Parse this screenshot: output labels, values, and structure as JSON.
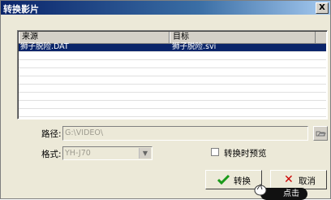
{
  "window": {
    "title": "转换影片",
    "close_label": "X"
  },
  "list": {
    "columns": [
      "来源",
      "目标"
    ],
    "rows": [
      {
        "source": "狮子脱险.DAT",
        "target": "狮子脱险.svi",
        "selected": true
      }
    ]
  },
  "path": {
    "label": "路径:",
    "value": "G:\\VIDEO\\"
  },
  "format": {
    "label": "格式:",
    "value": "YH-J70"
  },
  "preview": {
    "label": "转换时预览",
    "checked": false
  },
  "buttons": {
    "convert_label": "转换",
    "cancel_label": "取消"
  },
  "overlay": {
    "click_hint": "点击"
  },
  "colors": {
    "title_bar": "#0a246a",
    "selection": "#0a246a",
    "check": "#1a9a1a",
    "cancel_x": "#cc0000"
  },
  "icons": {
    "close": "close-icon",
    "browse": "folder-browse-icon",
    "convert": "checkmark-icon",
    "cancel": "x-icon",
    "cursor": "hand-cursor-icon"
  }
}
